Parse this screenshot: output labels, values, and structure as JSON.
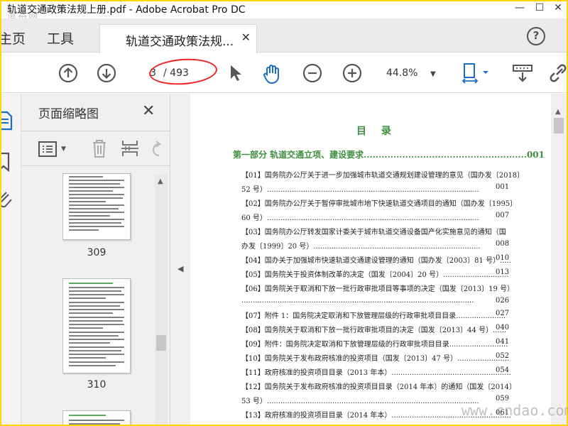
{
  "window": {
    "title": "轨道交通政策法规上册.pdf - Adobe Acrobat Pro DC",
    "watermark_top": "道裕网"
  },
  "tabs": {
    "home": "主页",
    "tools": "工具",
    "document": "轨道交通政策法规...",
    "close_symbol": "✕",
    "help_symbol": "?"
  },
  "toolbar": {
    "current_page": "3",
    "total_pages": "/ 493",
    "zoom": "44.8%"
  },
  "thumbnails": {
    "panel_title": "页面缩略图",
    "close_symbol": "✕",
    "items": [
      {
        "label": "309"
      },
      {
        "label": "310"
      }
    ]
  },
  "document": {
    "toc_heading": "目 录",
    "part1": "第一部分 轨道交通立项、建设要求.......................................................001",
    "lines": [
      {
        "text": "【01】国务院办公厅关于进一步加强城市轨道交通规划建设管理的意见（国办发〔2018〕",
        "page": ""
      },
      {
        "text": "52 号）..............................................................................................",
        "page": "001"
      },
      {
        "text": "【02】国务院办公厅关于暂停审批城市地下快速轨道交通项目的通知（国办发〔1995〕",
        "page": ""
      },
      {
        "text": "60 号）..............................................................................................",
        "page": "007"
      },
      {
        "text": "【03】国务院办公厅转发国家计委关于城市轨道交通设备国产化实施意见的通知（国",
        "page": ""
      },
      {
        "text": "办发〔1999〕20 号）..........................................................................",
        "page": "008"
      },
      {
        "text": "【04】国办关于加强城市快速轨道交通建设管理的通知（国办发〔2003〕81 号）.....",
        "page": "010"
      },
      {
        "text": "【05】国务院关于投资体制改革的决定（国发〔2004〕20 号）.............................",
        "page": "013"
      },
      {
        "text": "【06】国务院关于取消和下放一批行政审批项目等事项的决定（国发〔2013〕19 号）",
        "page": ""
      },
      {
        "text": ".......................................................................................................",
        "page": "026"
      },
      {
        "text": "【07】附件 1：国务院决定取消和下放管理层级的行政审批项目目录......................",
        "page": "027"
      },
      {
        "text": "【08】国务院关于取消和下放一批行政审批项目的决定（国发〔2013〕44 号）......",
        "page": "040"
      },
      {
        "text": "【09】附件：国务院决定取消和下放管理层级的行政审批项目目录..........................",
        "page": "041"
      },
      {
        "text": "【10】国务院关于发布政府核准的投资项目（国发〔2013〕47 号）.......................",
        "page": "052"
      },
      {
        "text": "【11】政府核准的投资项目目录（2013 年本）.....................................................",
        "page": "054"
      },
      {
        "text": "【12】国务院关于发布政府核准的投资项目目录（2014 年本）的通知（国发〔2014〕",
        "page": ""
      },
      {
        "text": "53 号）..............................................................................................",
        "page": "059"
      },
      {
        "text": "【13】政府核准的投资项目目录（2014 年本）.....................................................",
        "page": "061"
      }
    ],
    "watermark_bottom": "www.cndao.com"
  }
}
